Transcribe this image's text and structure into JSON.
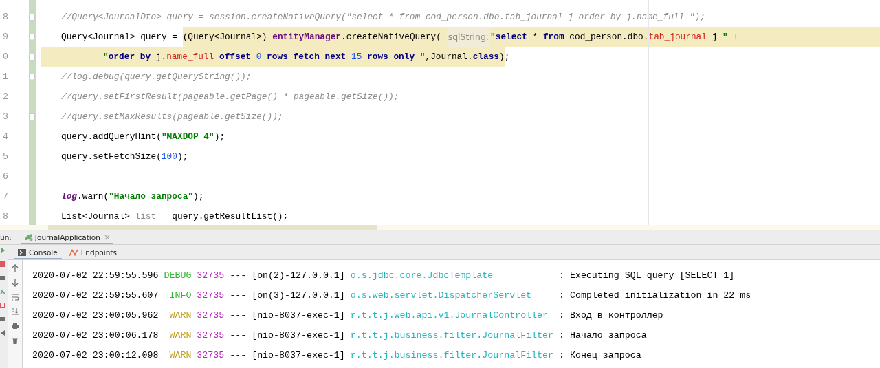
{
  "editor": {
    "lines": [
      {
        "number": "8",
        "fold_start": true,
        "fold_end": false,
        "continuation": false,
        "segments": [
          {
            "kind": "code",
            "highlighted": false,
            "tokens": [
              {
                "kind": "comment",
                "text": "//Query<JournalDto> query = session.createNativeQuery(\"select * from cod_person.dbo.tab_journal j order by j.name_full \");"
              }
            ]
          }
        ]
      },
      {
        "number": "9",
        "fold_start": false,
        "fold_end": true,
        "continuation": false,
        "segments": [
          {
            "kind": "code",
            "highlighted": false,
            "tokens": [
              {
                "kind": "plain",
                "text": "Query<Journal> query = "
              }
            ]
          },
          {
            "kind": "code",
            "highlighted": true,
            "tokens": [
              {
                "kind": "plain",
                "text": "(Query<Journal>) "
              },
              {
                "kind": "static",
                "text": "entityManager"
              },
              {
                "kind": "plain",
                "text": ".createNativeQuery( "
              }
            ]
          },
          {
            "kind": "hint",
            "text": "sqlString:"
          },
          {
            "kind": "code",
            "highlighted": true,
            "tokens": [
              {
                "kind": "quote",
                "text": "\""
              },
              {
                "kind": "keyword",
                "text": "select"
              },
              {
                "kind": "plain",
                "text": " * "
              },
              {
                "kind": "keyword",
                "text": "from"
              },
              {
                "kind": "plain",
                "text": " cod_person.dbo."
              },
              {
                "kind": "field",
                "text": "tab_journal"
              },
              {
                "kind": "plain",
                "text": " j "
              },
              {
                "kind": "quote",
                "text": "\""
              },
              {
                "kind": "plain",
                "text": " +"
              }
            ]
          }
        ]
      },
      {
        "number": "0",
        "fold_start": true,
        "fold_end": false,
        "continuation": true,
        "segments": [
          {
            "kind": "code",
            "highlighted": true,
            "tokens": [
              {
                "kind": "quote",
                "text": "\""
              },
              {
                "kind": "keyword",
                "text": "order by"
              },
              {
                "kind": "plain",
                "text": " j."
              },
              {
                "kind": "field",
                "text": "name_full"
              },
              {
                "kind": "keyword",
                "text": " offset "
              },
              {
                "kind": "number",
                "text": "0"
              },
              {
                "kind": "keyword",
                "text": " rows fetch next "
              },
              {
                "kind": "number",
                "text": "15"
              },
              {
                "kind": "keyword",
                "text": " rows only "
              },
              {
                "kind": "quote",
                "text": "\""
              },
              {
                "kind": "plain",
                "text": ",Journal."
              },
              {
                "kind": "keyword",
                "text": "class"
              },
              {
                "kind": "plain",
                "text": ")"
              }
            ]
          },
          {
            "kind": "code",
            "highlighted": false,
            "tokens": [
              {
                "kind": "plain",
                "text": ";"
              }
            ]
          }
        ]
      },
      {
        "number": "1",
        "fold_start": false,
        "fold_end": true,
        "continuation": false,
        "segments": [
          {
            "kind": "code",
            "highlighted": false,
            "tokens": [
              {
                "kind": "comment",
                "text": "//log.debug(query.getQueryString());"
              }
            ]
          }
        ]
      },
      {
        "number": "2",
        "fold_start": false,
        "fold_end": false,
        "continuation": false,
        "segments": [
          {
            "kind": "code",
            "highlighted": false,
            "tokens": [
              {
                "kind": "comment",
                "text": "//query.setFirstResult(pageable.getPage() * pageable.getSize());"
              }
            ]
          }
        ]
      },
      {
        "number": "3",
        "fold_start": true,
        "fold_end": false,
        "continuation": false,
        "segments": [
          {
            "kind": "code",
            "highlighted": false,
            "tokens": [
              {
                "kind": "comment",
                "text": "//query.setMaxResults(pageable.getSize());"
              }
            ]
          }
        ]
      },
      {
        "number": "4",
        "fold_start": false,
        "fold_end": false,
        "continuation": false,
        "segments": [
          {
            "kind": "code",
            "highlighted": false,
            "tokens": [
              {
                "kind": "plain",
                "text": "query.addQueryHint("
              },
              {
                "kind": "string",
                "text": "\"MAXDOP 4\""
              },
              {
                "kind": "plain",
                "text": ");"
              }
            ]
          }
        ]
      },
      {
        "number": "5",
        "fold_start": false,
        "fold_end": false,
        "continuation": false,
        "segments": [
          {
            "kind": "code",
            "highlighted": false,
            "tokens": [
              {
                "kind": "plain",
                "text": "query.setFetchSize("
              },
              {
                "kind": "number",
                "text": "100"
              },
              {
                "kind": "plain",
                "text": ");"
              }
            ]
          }
        ]
      },
      {
        "number": "6",
        "fold_start": false,
        "fold_end": false
      },
      {
        "number": "7",
        "fold_start": false,
        "fold_end": false,
        "continuation": false,
        "segments": [
          {
            "kind": "code",
            "highlighted": false,
            "tokens": [
              {
                "kind": "staticitalic",
                "text": "log"
              },
              {
                "kind": "plain",
                "text": ".warn("
              },
              {
                "kind": "string",
                "text": "\"Начало запроса\""
              },
              {
                "kind": "plain",
                "text": ");"
              }
            ]
          }
        ]
      },
      {
        "number": "8",
        "fold_start": false,
        "fold_end": false,
        "continuation": false,
        "segments": [
          {
            "kind": "code",
            "highlighted": false,
            "tokens": [
              {
                "kind": "plain",
                "text": "List<Journal> "
              },
              {
                "kind": "unused",
                "text": "list"
              },
              {
                "kind": "plain",
                "text": " = query.getResultList();"
              }
            ]
          }
        ]
      }
    ]
  },
  "run_panel": {
    "label": "un:",
    "tabs": [
      {
        "label": "JournalApplication",
        "selected": true
      }
    ],
    "console_tabs": [
      {
        "label": "Console",
        "selected": true
      },
      {
        "label": "Endpoints",
        "selected": false
      }
    ],
    "log": [
      {
        "time": "2020-07-02 22:59:55.596",
        "level": "DEBUG",
        "kind": "debug",
        "pid": "32735",
        "separator": "---",
        "thread": "[on(2)-127.0.0.1]",
        "logger": "o.s.jdbc.core.JdbcTemplate",
        "message": ": Executing SQL query [SELECT 1]"
      },
      {
        "time": "2020-07-02 22:59:55.607",
        "level": "INFO",
        "kind": "info",
        "pid": "32735",
        "separator": "---",
        "thread": "[on(3)-127.0.0.1]",
        "logger": "o.s.web.servlet.DispatcherServlet",
        "message": ": Completed initialization in 22 ms"
      },
      {
        "time": "2020-07-02 23:00:05.962",
        "level": "WARN",
        "kind": "warn",
        "pid": "32735",
        "separator": "---",
        "thread": "[nio-8037-exec-1]",
        "logger": "r.t.t.j.web.api.v1.JournalController",
        "message": ": Вход в контроллер"
      },
      {
        "time": "2020-07-02 23:00:06.178",
        "level": "WARN",
        "kind": "warn",
        "pid": "32735",
        "separator": "---",
        "thread": "[nio-8037-exec-1]",
        "logger": "r.t.t.j.business.filter.JournalFilter",
        "message": ": Начало запроса"
      },
      {
        "time": "2020-07-02 23:00:12.098",
        "level": "WARN",
        "kind": "warn",
        "pid": "32735",
        "separator": "---",
        "thread": "[nio-8037-exec-1]",
        "logger": "r.t.t.j.business.filter.JournalFilter",
        "message": ": Конец запроса"
      }
    ]
  }
}
